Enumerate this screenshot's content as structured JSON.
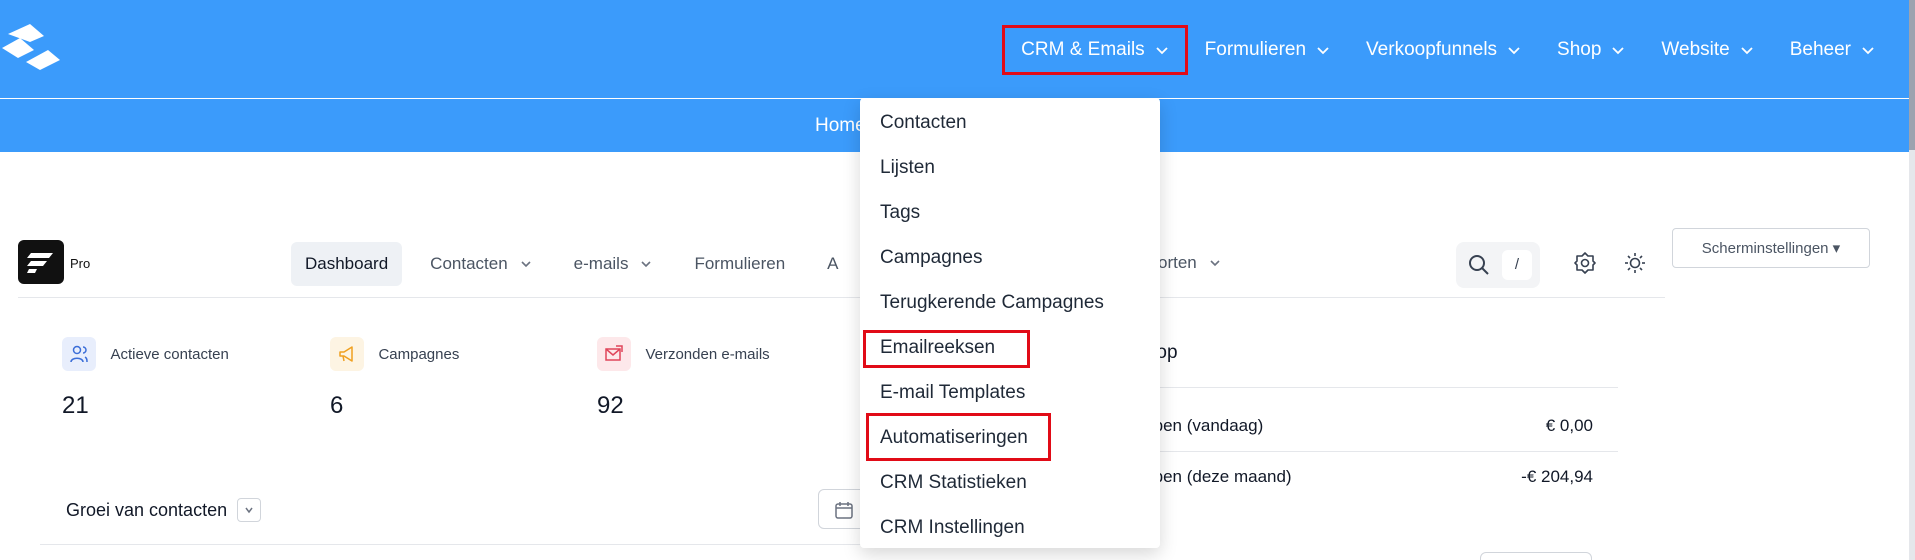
{
  "topbar": {
    "nav": [
      {
        "label": "CRM & Emails"
      },
      {
        "label": "Formulieren"
      },
      {
        "label": "Verkoopfunnels"
      },
      {
        "label": "Shop"
      },
      {
        "label": "Website"
      },
      {
        "label": "Beheer"
      }
    ]
  },
  "subbar": {
    "home": "Home"
  },
  "dropdown": {
    "items": [
      "Contacten",
      "Lijsten",
      "Tags",
      "Campagnes",
      "Terugkerende Campagnes",
      "Emailreeksen",
      "E-mail Templates",
      "Automatiseringen",
      "CRM Statistieken",
      "CRM Instellingen"
    ]
  },
  "app": {
    "logo_label": "Pro",
    "subnav": [
      {
        "label": "Dashboard"
      },
      {
        "label": "Contacten"
      },
      {
        "label": "e-mails"
      },
      {
        "label": "Formulieren"
      },
      {
        "label": "A"
      }
    ],
    "hidden_tail": "orten",
    "search_shortcut": "/",
    "screen_settings": "Scherminstellingen ▾"
  },
  "stats": [
    {
      "label": "Actieve contacten",
      "value": "21",
      "icon": "users-icon"
    },
    {
      "label": "Campagnes",
      "value": "6",
      "icon": "megaphone-icon"
    },
    {
      "label": "Verzonden e-mails",
      "value": "92",
      "icon": "mail-sent-icon"
    }
  ],
  "sales": {
    "title": "rkoop",
    "rows": [
      {
        "label": "rkopen (vandaag)",
        "value": "€ 0,00"
      },
      {
        "label": "rkopen (deze maand)",
        "value": "-€ 204,94"
      }
    ]
  },
  "growth": {
    "title": "Groei van contacten"
  },
  "colors": {
    "brand": "#3b9bfb",
    "highlight": "#e10b17"
  }
}
